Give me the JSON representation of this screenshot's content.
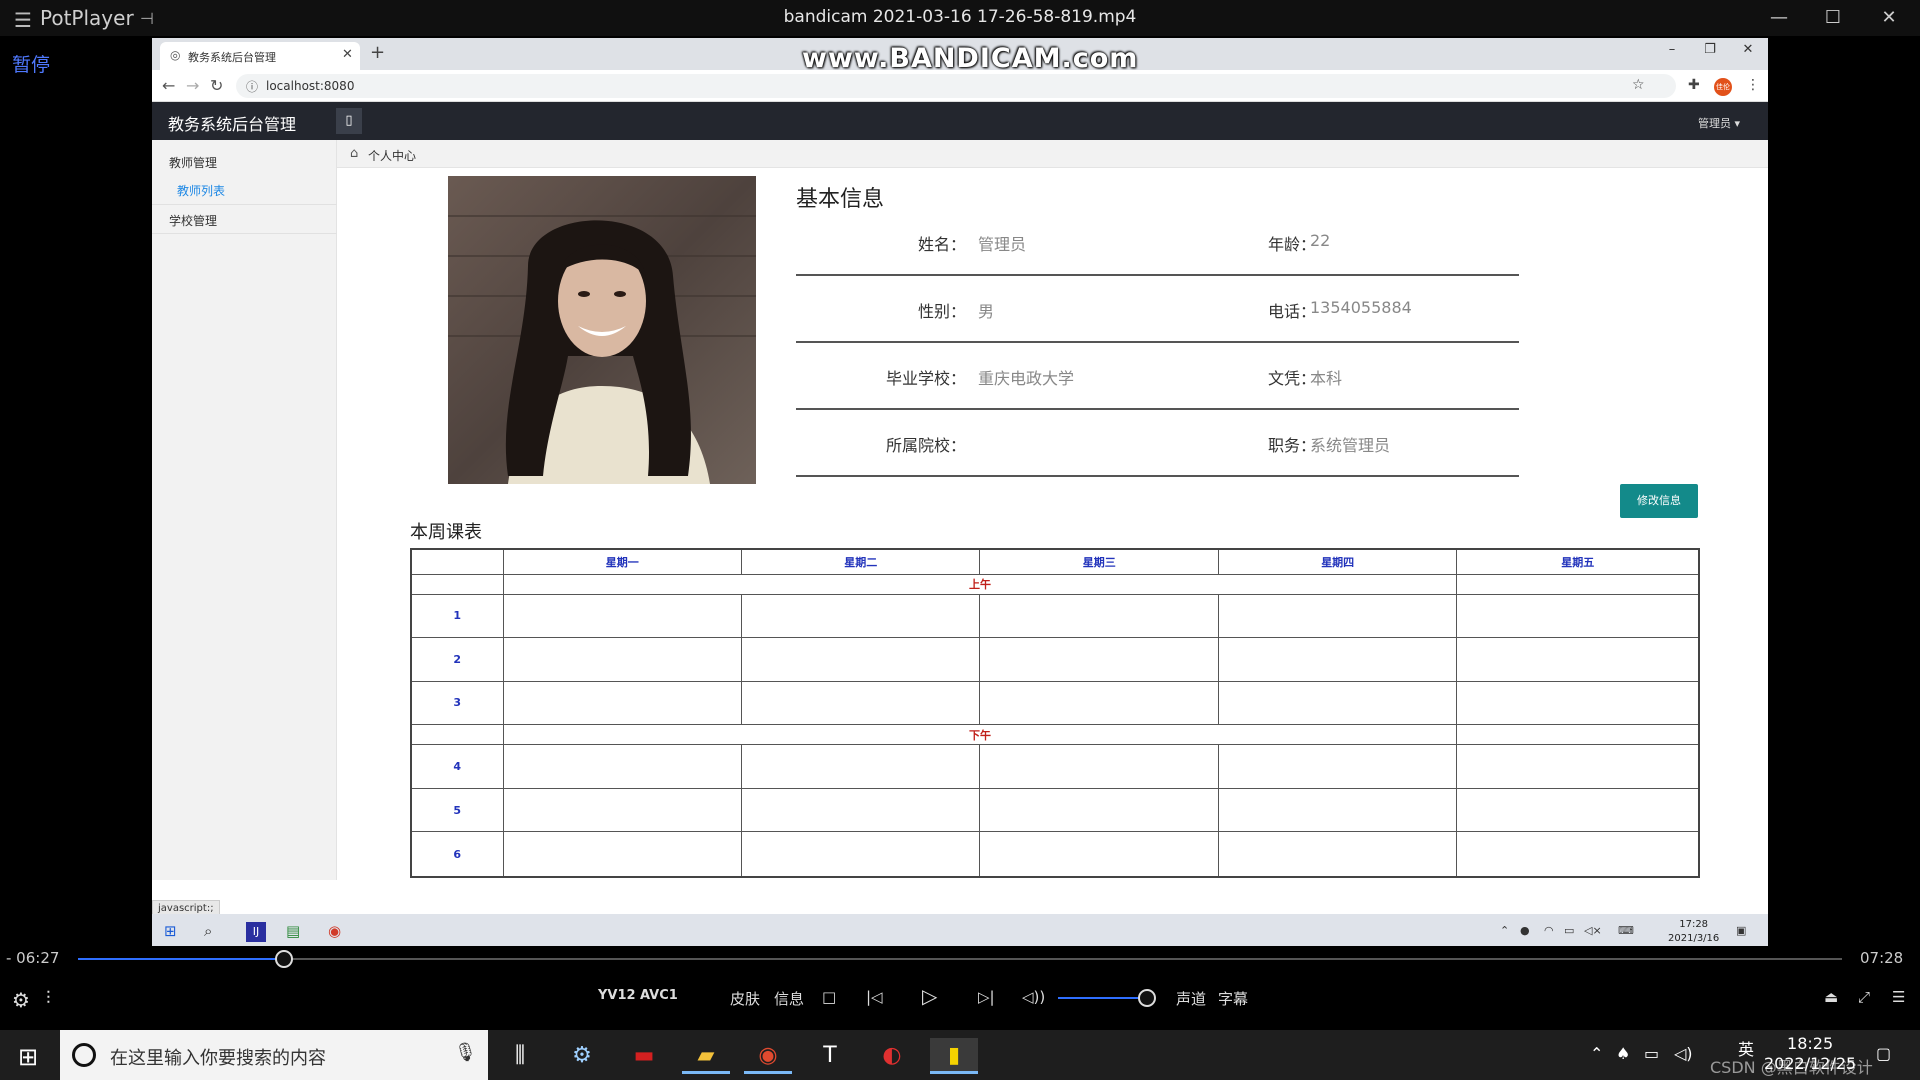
{
  "player": {
    "menu_icon": "☰",
    "brand": "PotPlayer",
    "pin_icon": "pin-icon",
    "filename": "bandicam 2021-03-16 17-26-58-819.mp4",
    "pause_label": "暂停",
    "watermark": "www.BANDICAM.com",
    "time_current": "- 06:27",
    "time_total": "07:28",
    "progress_fraction": 0.117,
    "codec1": "YV12",
    "codec2": "AVC1",
    "skin": "皮肤",
    "info": "信息",
    "audio": "声道",
    "subtitle": "字幕",
    "volume_fraction": 0.85
  },
  "browser": {
    "tab_title": "教务系统后台管理",
    "url": "localhost:8080",
    "status_tip": "javascript:;",
    "ext_avatar": "佳伦"
  },
  "app": {
    "title": "教务系统后台管理",
    "toggle_icon": "▯",
    "user_menu": "管理员 ▾",
    "sidebar": {
      "items": [
        {
          "label": "教师管理"
        },
        {
          "label": "教师列表"
        },
        {
          "label": "学校管理"
        }
      ]
    },
    "breadcrumb": "个人中心",
    "info_title": "基本信息",
    "fields": [
      {
        "label": "姓名：",
        "value": "管理员"
      },
      {
        "label": "年龄：",
        "value": "22"
      },
      {
        "label": "性别：",
        "value": "男"
      },
      {
        "label": "电话：",
        "value": "1354055884"
      },
      {
        "label": "毕业学校：",
        "value": "重庆电政大学"
      },
      {
        "label": "文凭：",
        "value": "本科"
      },
      {
        "label": "所属院校：",
        "value": ""
      },
      {
        "label": "职务：",
        "value": "系统管理员"
      }
    ],
    "edit_button": "修改信息",
    "schedule_title": "本周课表",
    "weekdays": [
      "星期一",
      "星期二",
      "星期三",
      "星期四",
      "星期五"
    ],
    "morning": "上午",
    "afternoon": "下午",
    "periods": [
      "1",
      "2",
      "3",
      "4",
      "5",
      "6"
    ]
  },
  "inner_taskbar": {
    "clock_time": "17:28",
    "clock_date": "2021/3/16"
  },
  "windows": {
    "search_placeholder": "在这里输入你要搜索的内容",
    "clock_time": "18:25",
    "clock_date": "2022/12/25",
    "lang": "英",
    "overlay_note": "CSDN @黑白软件设计"
  }
}
